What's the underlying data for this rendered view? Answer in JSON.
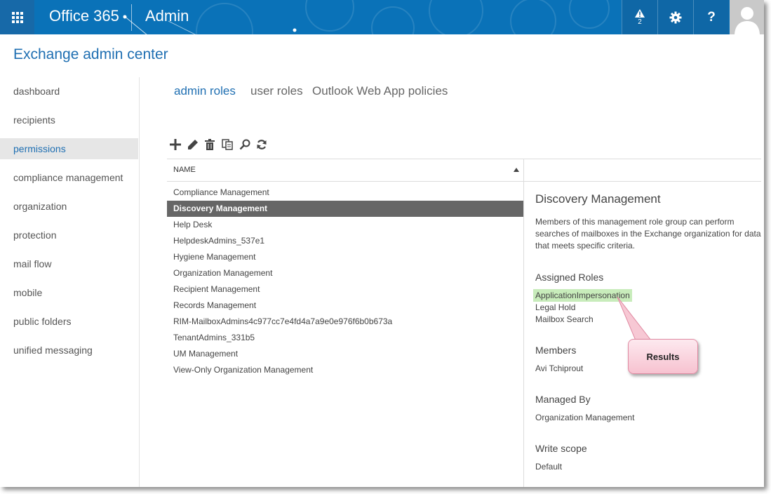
{
  "topbar": {
    "product": "Office 365",
    "section": "Admin",
    "alerts_count": "2",
    "icons": [
      "waffle-icon",
      "alert-icon",
      "gear-icon",
      "help-icon",
      "avatar-icon"
    ],
    "accent": "#0a72b8"
  },
  "app_title": "Exchange admin center",
  "nav": {
    "items": [
      {
        "label": "dashboard"
      },
      {
        "label": "recipients"
      },
      {
        "label": "permissions",
        "active": true
      },
      {
        "label": "compliance management"
      },
      {
        "label": "organization"
      },
      {
        "label": "protection"
      },
      {
        "label": "mail flow"
      },
      {
        "label": "mobile"
      },
      {
        "label": "public folders"
      },
      {
        "label": "unified messaging"
      }
    ]
  },
  "tabs": [
    {
      "label": "admin roles",
      "active": true
    },
    {
      "label": "user roles"
    },
    {
      "label": "Outlook Web App policies"
    }
  ],
  "toolbar": {
    "icons": [
      "add-icon",
      "edit-icon",
      "delete-icon",
      "copy-icon",
      "search-icon",
      "refresh-icon"
    ]
  },
  "list": {
    "column_header": "NAME",
    "rows": [
      "Compliance Management",
      "Discovery Management",
      "Help Desk",
      "HelpdeskAdmins_537e1",
      "Hygiene Management",
      "Organization Management",
      "Recipient Management",
      "Records Management",
      "RIM-MailboxAdmins4c977cc7e4fd4a7a9e0e976f6b0b673a",
      "TenantAdmins_331b5",
      "UM Management",
      "View-Only Organization Management"
    ],
    "selected_index": 1
  },
  "details": {
    "title": "Discovery Management",
    "description": "Members of this management role group can perform searches of mailboxes in the Exchange organization for data that meets specific criteria.",
    "assigned_roles_heading": "Assigned Roles",
    "assigned_roles": [
      "ApplicationImpersonation",
      "Legal Hold",
      "Mailbox Search"
    ],
    "members_heading": "Members",
    "members": [
      "Avi Tchiprout"
    ],
    "managed_by_heading": "Managed By",
    "managed_by": "Organization Management",
    "write_scope_heading": "Write scope",
    "write_scope": "Default"
  },
  "callout": {
    "label": "Results",
    "color": "#f7c2d0"
  },
  "highlight_color": "#c8ecbb"
}
